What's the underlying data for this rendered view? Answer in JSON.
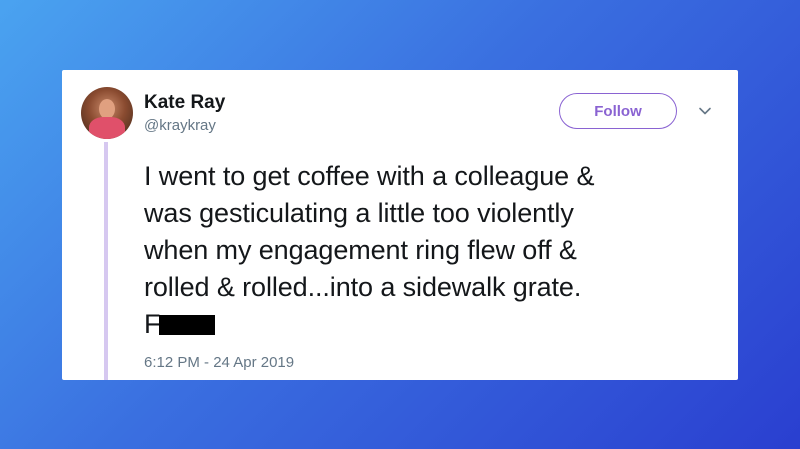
{
  "background": {
    "gradient_start": "#4aa3f0",
    "gradient_end": "#2a3fd0"
  },
  "tweet": {
    "author_name": "Kate Ray",
    "author_handle": "@kraykray",
    "follow_label": "Follow",
    "accent_color": "#8a63d2",
    "text_lines": [
      "I went to get coffee with a colleague &",
      "was gesticulating a little too violently",
      "when my engagement ring flew off &",
      "rolled & rolled...into a sidewalk grate."
    ],
    "last_line_visible": "F",
    "timestamp": "6:12 PM - 24 Apr 2019",
    "menu_icon": "chevron-down-icon"
  }
}
